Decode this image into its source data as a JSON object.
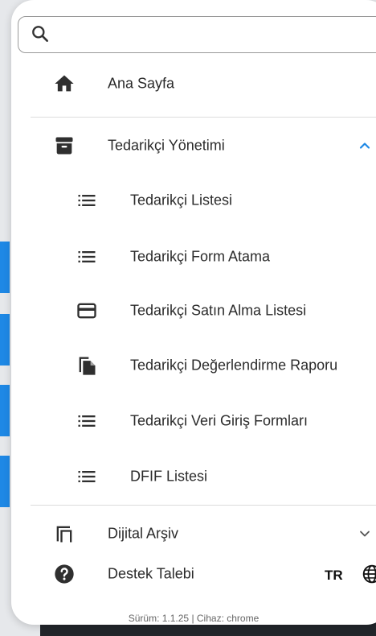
{
  "search": {
    "placeholder": "",
    "value": ""
  },
  "menu": {
    "home": {
      "label": "Ana Sayfa",
      "icon": "home-icon"
    },
    "supplier_management": {
      "label": "Tedarikçi Yönetimi",
      "icon": "archive-icon",
      "expanded": true,
      "children": [
        {
          "label": "Tedarikçi Listesi",
          "icon": "list-icon"
        },
        {
          "label": "Tedarikçi Form Atama",
          "icon": "list-icon"
        },
        {
          "label": "Tedarikçi Satın Alma Listesi",
          "icon": "credit-card-icon"
        },
        {
          "label": "Tedarikçi Değerlendirme Raporu",
          "icon": "file-copy-icon"
        },
        {
          "label": "Tedarikçi Veri Giriş Formları",
          "icon": "list-icon"
        },
        {
          "label": "DFIF Listesi",
          "icon": "list-icon"
        }
      ]
    },
    "digital_archive": {
      "label": "Dijital Arşiv",
      "icon": "library-icon",
      "expanded": false
    },
    "support": {
      "label": "Destek Talebi",
      "icon": "help-circle-icon"
    }
  },
  "language": {
    "code": "TR",
    "icon": "globe-icon"
  },
  "footer": {
    "version_text": "Sürüm: 1.1.25 | Cihaz: chrome"
  },
  "colors": {
    "accent": "#1e88e5",
    "icon": "#2f2f2f",
    "text": "#2b2b2b"
  }
}
